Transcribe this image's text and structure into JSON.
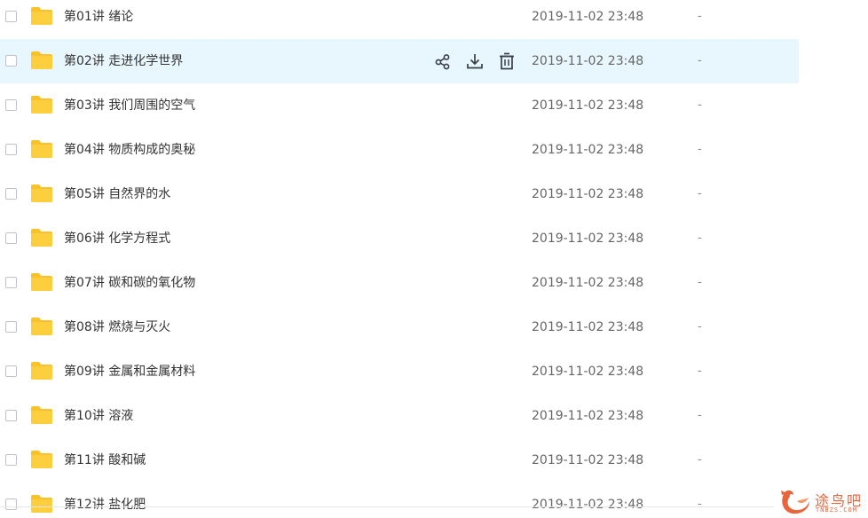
{
  "file_list": {
    "rows": [
      {
        "name": "第01讲 绪论",
        "modified": "2019-11-02 23:48",
        "size": "-"
      },
      {
        "name": "第02讲 走进化学世界",
        "modified": "2019-11-02 23:48",
        "size": "-",
        "hovered": true
      },
      {
        "name": "第03讲 我们周围的空气",
        "modified": "2019-11-02 23:48",
        "size": "-"
      },
      {
        "name": "第04讲 物质构成的奥秘",
        "modified": "2019-11-02 23:48",
        "size": "-"
      },
      {
        "name": "第05讲 自然界的水",
        "modified": "2019-11-02 23:48",
        "size": "-"
      },
      {
        "name": "第06讲 化学方程式",
        "modified": "2019-11-02 23:48",
        "size": "-"
      },
      {
        "name": "第07讲 碳和碳的氧化物",
        "modified": "2019-11-02 23:48",
        "size": "-"
      },
      {
        "name": "第08讲 燃烧与灭火",
        "modified": "2019-11-02 23:48",
        "size": "-"
      },
      {
        "name": "第09讲 金属和金属材料",
        "modified": "2019-11-02 23:48",
        "size": "-"
      },
      {
        "name": "第10讲 溶液",
        "modified": "2019-11-02 23:48",
        "size": "-"
      },
      {
        "name": "第11讲 酸和碱",
        "modified": "2019-11-02 23:48",
        "size": "-"
      },
      {
        "name": "第12讲 盐化肥",
        "modified": "2019-11-02 23:48",
        "size": "-"
      }
    ],
    "hover_actions": [
      "share-icon",
      "download-icon",
      "delete-icon"
    ]
  },
  "colors": {
    "hover_bg": "#e8f6fd",
    "folder": "#f9c22b",
    "icon": "#3a3f47",
    "watermark": "#e8643a"
  },
  "watermark": {
    "text": "途鸟吧",
    "sub": "TNBZS.COM"
  }
}
